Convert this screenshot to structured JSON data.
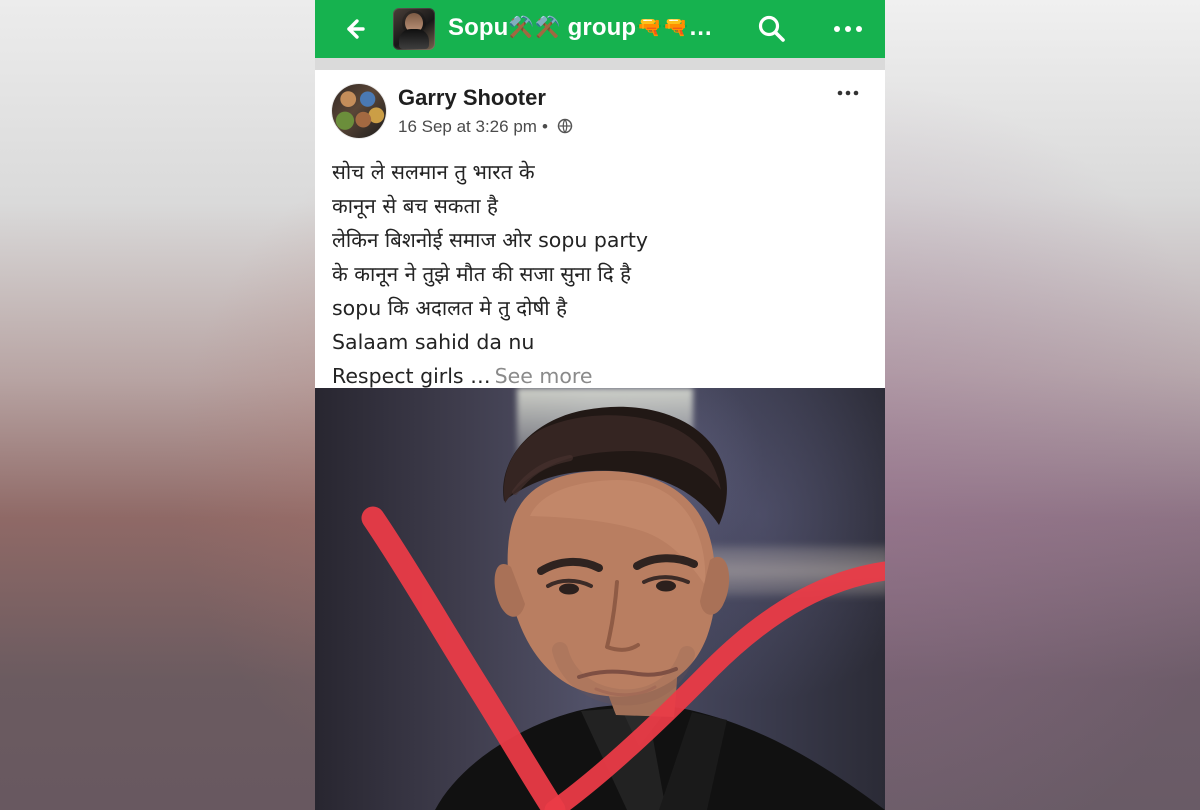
{
  "header": {
    "group_title": "Sopu",
    "group_icons_1": "⚒️",
    "group_icons_2": "⚒️",
    "group_title_suffix": "group",
    "group_icons_3": "🔫🔫",
    "truncation": "…",
    "back_icon": "back-arrow-icon",
    "search_icon": "search-icon",
    "more_icon": "more-icon",
    "color": "#16b24f"
  },
  "post": {
    "author": "Garry Shooter",
    "date": "16 Sep at 3:26 pm",
    "meta_separator": "•",
    "visibility_icon": "globe-icon",
    "more_icon": "more-icon",
    "text_lines": [
      "सोच ले सलमान तु भारत के",
      "कानून से बच सकता है",
      "लेकिन बिशनोई समाज ओर sopu party",
      "के कानून ने तुझे मौत की सजा सुना दि है",
      "sopu कि अदालत मे तु दोषी है",
      "Salaam sahid da nu",
      "Respect girls"
    ],
    "ellipsis": "…",
    "see_more": "See more"
  },
  "photo": {
    "description_icon": "photo-image",
    "accent_color": "#ea3b47"
  }
}
